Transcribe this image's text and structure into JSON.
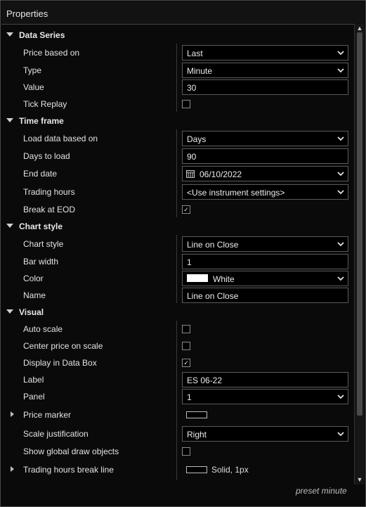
{
  "window": {
    "title": "Properties"
  },
  "rows": [
    {
      "kind": "cat",
      "label": "Data Series"
    },
    {
      "kind": "prop",
      "label": "Price based on",
      "ctl": "select",
      "value": "Last"
    },
    {
      "kind": "prop",
      "label": "Type",
      "ctl": "select",
      "value": "Minute"
    },
    {
      "kind": "prop",
      "label": "Value",
      "ctl": "text",
      "value": "30"
    },
    {
      "kind": "prop",
      "label": "Tick Replay",
      "ctl": "check",
      "checked": false
    },
    {
      "kind": "cat",
      "label": "Time frame"
    },
    {
      "kind": "prop",
      "label": "Load data based on",
      "ctl": "select",
      "value": "Days"
    },
    {
      "kind": "prop",
      "label": "Days to load",
      "ctl": "text",
      "value": "90"
    },
    {
      "kind": "prop",
      "label": "End date",
      "ctl": "date",
      "value": "06/10/2022"
    },
    {
      "kind": "prop",
      "label": "Trading hours",
      "ctl": "select",
      "value": "<Use instrument settings>"
    },
    {
      "kind": "prop",
      "label": "Break at EOD",
      "ctl": "check",
      "checked": true
    },
    {
      "kind": "cat",
      "label": "Chart style"
    },
    {
      "kind": "prop",
      "label": "Chart style",
      "ctl": "select",
      "value": "Line on Close"
    },
    {
      "kind": "prop",
      "label": "Bar width",
      "ctl": "text",
      "value": "1"
    },
    {
      "kind": "prop",
      "label": "Color",
      "ctl": "color",
      "value": "White",
      "color": "#ffffff"
    },
    {
      "kind": "prop",
      "label": "Name",
      "ctl": "text",
      "value": "Line on Close"
    },
    {
      "kind": "cat",
      "label": "Visual"
    },
    {
      "kind": "prop",
      "label": "Auto scale",
      "ctl": "check",
      "checked": false
    },
    {
      "kind": "prop",
      "label": "Center price on scale",
      "ctl": "check",
      "checked": false
    },
    {
      "kind": "prop",
      "label": "Display in Data Box",
      "ctl": "check",
      "checked": true
    },
    {
      "kind": "prop",
      "label": "Label",
      "ctl": "text",
      "value": "ES 06-22"
    },
    {
      "kind": "prop",
      "label": "Panel",
      "ctl": "select",
      "value": "1"
    },
    {
      "kind": "prop",
      "label": "Price marker",
      "ctl": "mini",
      "expandable": true
    },
    {
      "kind": "prop",
      "label": "Scale justification",
      "ctl": "select",
      "value": "Right"
    },
    {
      "kind": "prop",
      "label": "Show global draw objects",
      "ctl": "check",
      "checked": false
    },
    {
      "kind": "prop",
      "label": "Trading hours break line",
      "ctl": "mini",
      "value": "Solid, 1px",
      "expandable": true
    }
  ],
  "footer": {
    "text": "preset minute"
  },
  "colors": {
    "background": "#0a0a0a",
    "border": "#5a5a5a",
    "text": "#e6e6e6"
  },
  "icons": {
    "category_expanded": "triangle-down-icon",
    "expand": "triangle-right-icon",
    "dropdown": "chevron-down-icon",
    "date": "calendar-icon"
  }
}
